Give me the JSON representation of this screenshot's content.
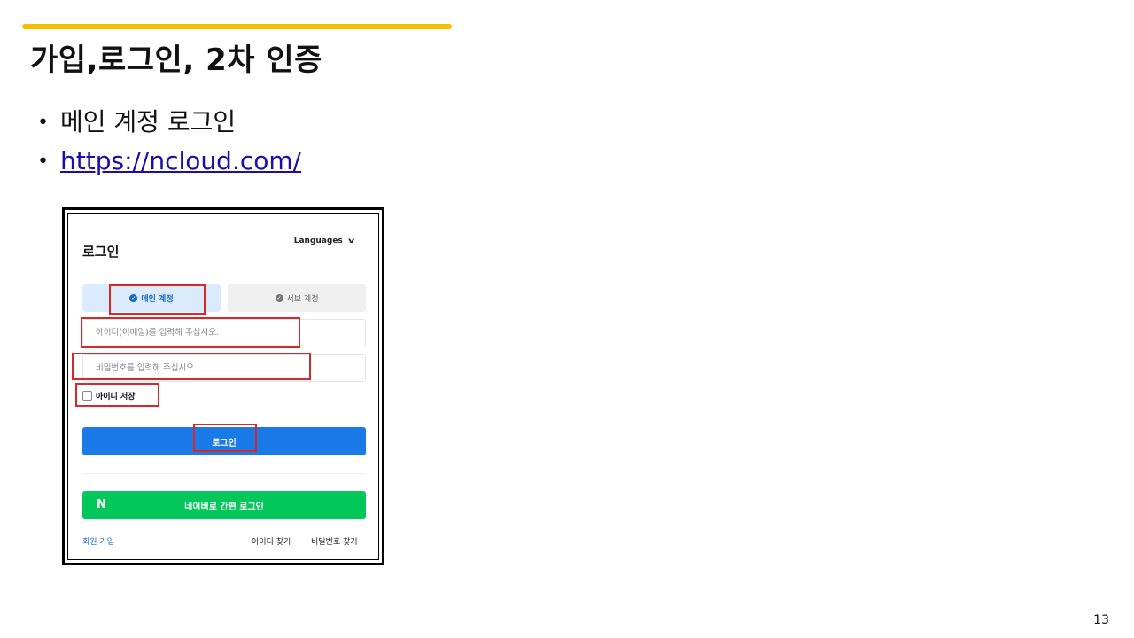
{
  "slide": {
    "title": "가입,로그인, 2차 인증",
    "bullets": [
      "메인 계정 로그인",
      "https://ncloud.com/"
    ],
    "bullet_char": "•",
    "page_number": "13",
    "accent_color": "#f5c000"
  },
  "login": {
    "title": "로그인",
    "languages_label": "Languages",
    "tabs": {
      "main": "메인 계정",
      "sub": "서브 계정"
    },
    "id_placeholder": "아이디(이메일)를 입력해 주십시오.",
    "pw_placeholder": "비밀번호를 입력해 주십시오.",
    "save_id_label": "아이디 저장",
    "login_button": "로그인",
    "naver_logo": "N",
    "naver_button": "네이버로 간편 로그인",
    "signup_link": "회원 가입",
    "find_id_link": "아이디 찾기",
    "find_pw_link": "비밀번호 찾기",
    "colors": {
      "primary": "#1a7ae8",
      "naver_green": "#03c75a",
      "highlight": "#d62828"
    }
  }
}
